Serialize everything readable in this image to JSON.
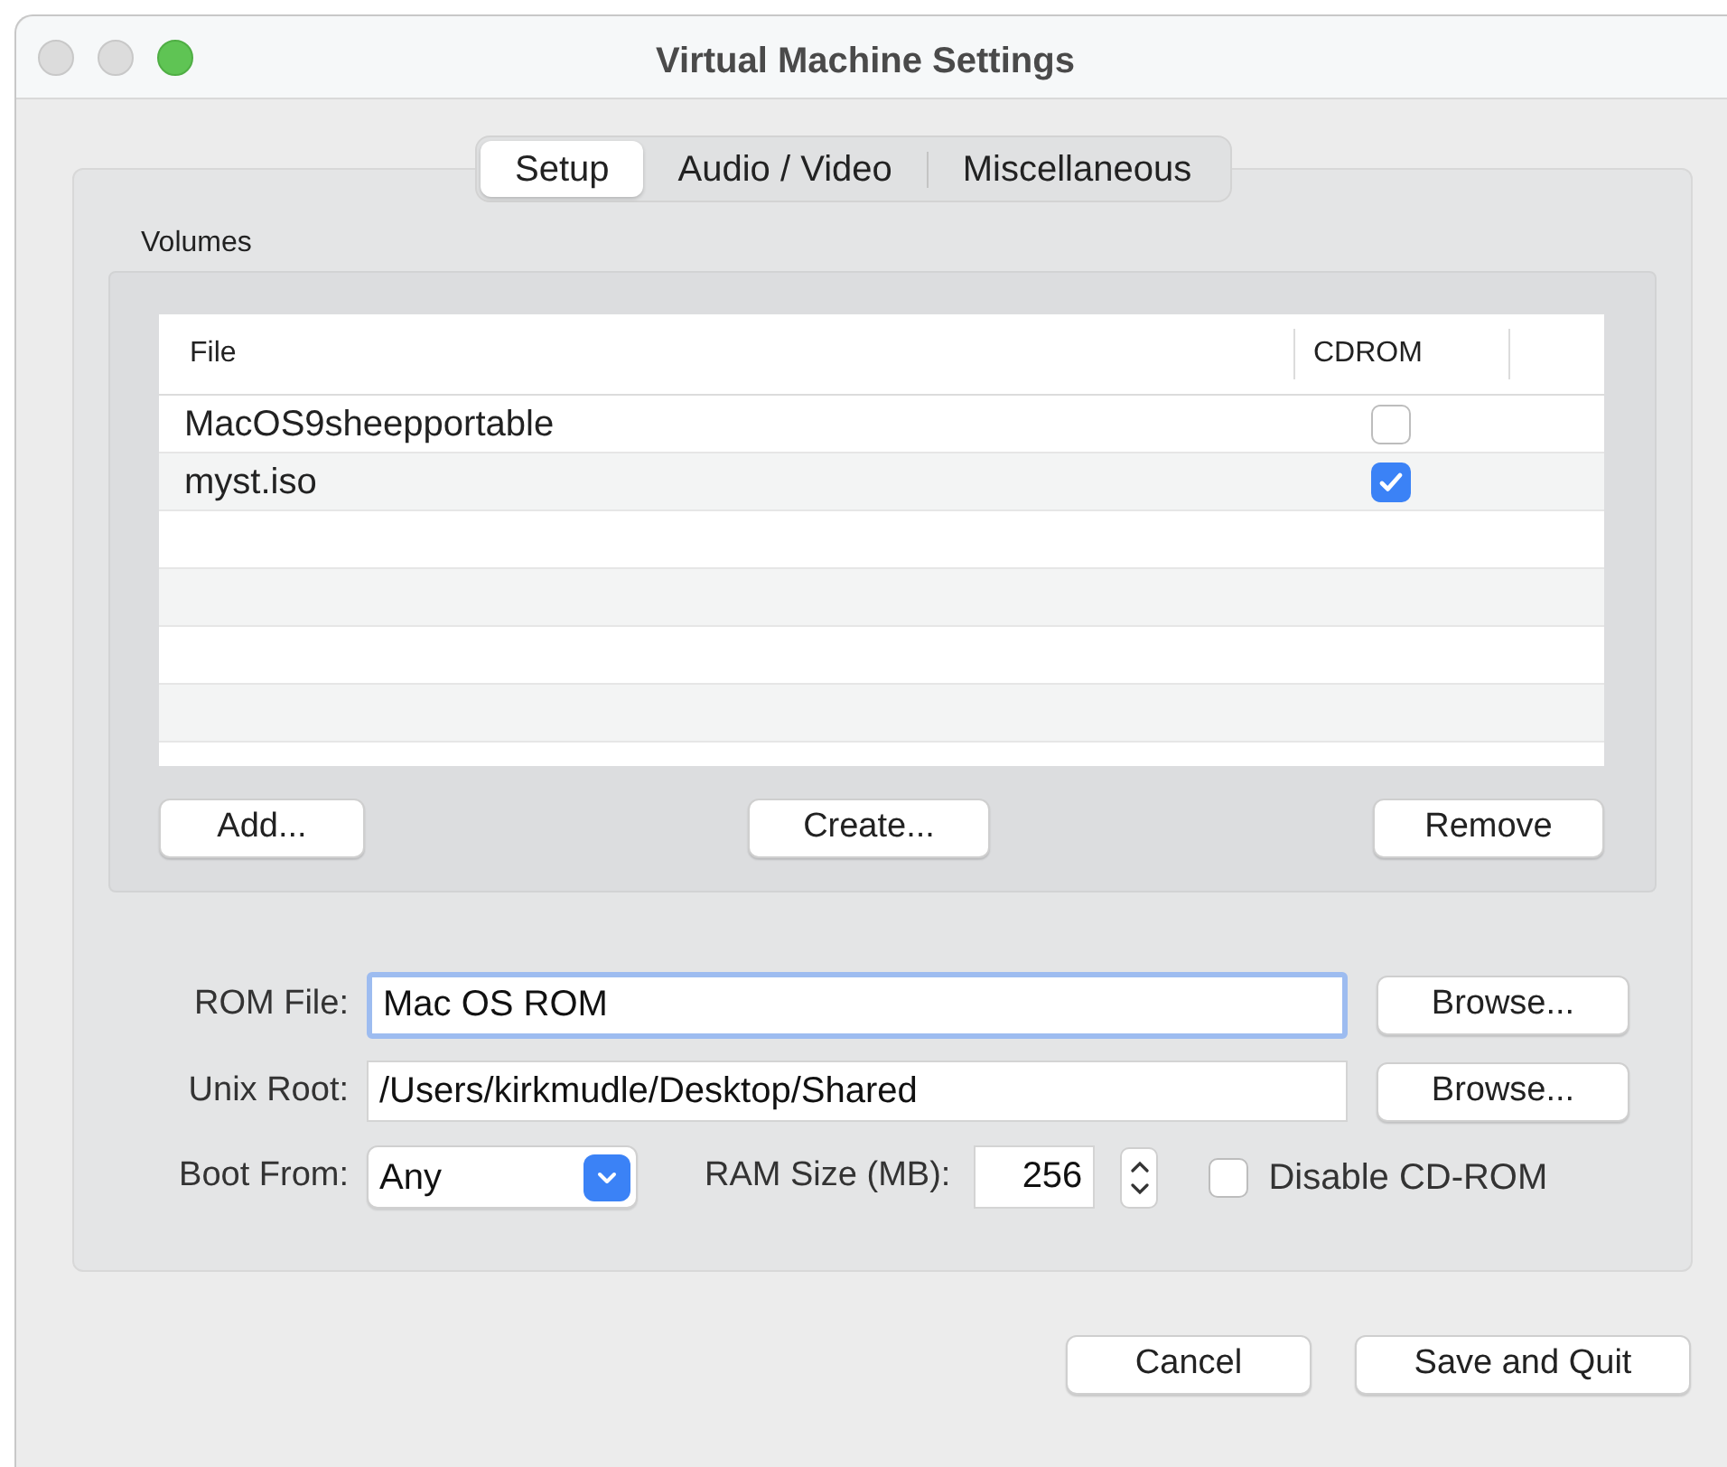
{
  "window": {
    "title": "Virtual Machine Settings"
  },
  "tabs": [
    {
      "label": "Setup",
      "selected": true
    },
    {
      "label": "Audio / Video",
      "selected": false
    },
    {
      "label": "Miscellaneous",
      "selected": false
    }
  ],
  "volumes": {
    "label": "Volumes",
    "columns": [
      "File",
      "CDROM"
    ],
    "rows": [
      {
        "file": "MacOS9sheepportable",
        "cdrom": false
      },
      {
        "file": "myst.iso",
        "cdrom": true
      }
    ],
    "buttons": [
      "Add...",
      "Create...",
      "Remove"
    ]
  },
  "rom_file": {
    "label": "ROM File:",
    "value": "Mac OS ROM",
    "button": "Browse..."
  },
  "unix_root": {
    "label": "Unix Root:",
    "value": "/Users/kirkmudle/Desktop/Shared",
    "button": "Browse..."
  },
  "boot_from": {
    "label": "Boot From:",
    "value": "Any"
  },
  "ram_size": {
    "label": "RAM Size (MB):",
    "value": "256"
  },
  "disable_cdrom": {
    "label": "Disable CD-ROM",
    "checked": false
  },
  "buttons": [
    "Cancel",
    "Save and Quit"
  ]
}
